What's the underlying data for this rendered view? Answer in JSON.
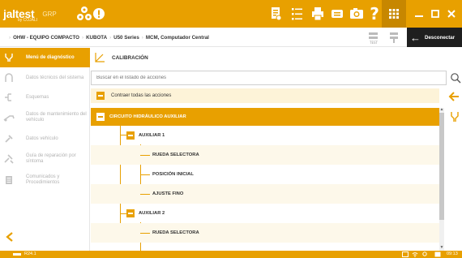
{
  "header": {
    "brand": "jaltest",
    "brand_sub": "by COJALI",
    "product": "GRP",
    "colors": {
      "accent": "#e8a000",
      "dark": "#1f1f1f"
    },
    "icons": [
      "grp-logo-icon",
      "alert-icon",
      "document-icon",
      "list-icon",
      "printer-icon",
      "chat-icon",
      "camera-icon",
      "help-icon",
      "apps-grid-icon",
      "minimize-icon",
      "maximize-icon",
      "close-icon"
    ]
  },
  "breadcrumb": {
    "items": [
      "OHW - EQUIPO COMPACTO",
      "KUBOTA",
      "U50 Series",
      "MCM, Computador Central"
    ],
    "test_icon": "test-icon",
    "connect_icon": "connector-icon",
    "disconnect_label": "Desconectar"
  },
  "sidebar": {
    "items": [
      {
        "label": "Menú de diagnóstico",
        "icon": "diagnostic-icon",
        "active": true
      },
      {
        "label": "Datos técnicos del sistema",
        "icon": "technical-data-icon",
        "active": false
      },
      {
        "label": "Esquemas",
        "icon": "schematics-icon",
        "active": false
      },
      {
        "label": "Datos de mantenimiento del vehículo",
        "icon": "maintenance-icon",
        "active": false
      },
      {
        "label": "Datos vehículo",
        "icon": "vehicle-data-icon",
        "active": false
      },
      {
        "label": "Guía de reparación por síntoma",
        "icon": "repair-guide-icon",
        "active": false
      },
      {
        "label": "Comunicados y Procedimientos",
        "icon": "bulletins-icon",
        "active": false
      }
    ],
    "back_icon": "chevron-left-icon"
  },
  "main": {
    "title": "CALIBRACIÓN",
    "search": {
      "placeholder": "Buscar en el listado de acciones",
      "value": ""
    },
    "collapse_all_label": "Contraer todas las acciones",
    "tree": [
      {
        "label": "CIRCUITO HIDRÁULICO AUXILIAR",
        "level": 0
      },
      {
        "label": "AUXILIAR 1",
        "level": 1
      },
      {
        "label": "RUEDA SELECTORA",
        "level": 2
      },
      {
        "label": "POSICIÓN INICIAL",
        "level": 2
      },
      {
        "label": "AJUSTE FINO",
        "level": 2
      },
      {
        "label": "AUXILIAR 2",
        "level": 1
      },
      {
        "label": "RUEDA SELECTORA",
        "level": 2
      }
    ]
  },
  "status": {
    "version": "R24.1",
    "time": "09:13"
  }
}
